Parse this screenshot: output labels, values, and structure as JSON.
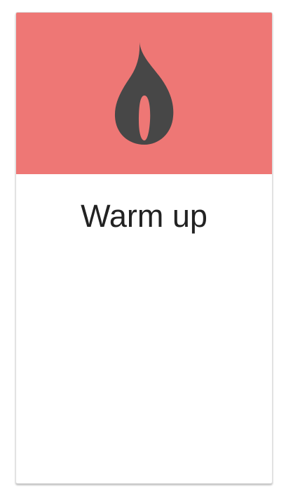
{
  "card": {
    "title": "Warm up",
    "header_color": "#ee7775",
    "icon": "flame-icon",
    "icon_color": "#474747"
  }
}
